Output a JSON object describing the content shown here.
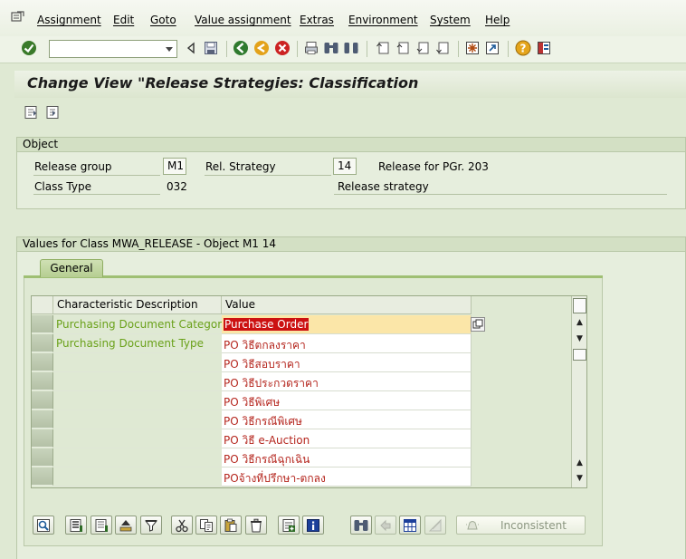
{
  "menu": [
    "Assignment",
    "Edit",
    "Goto",
    "Value assignment",
    "Extras",
    "Environment",
    "System",
    "Help"
  ],
  "command_field": {
    "value": ""
  },
  "title": "Change View \"Release Strategies: Classification",
  "object_group": {
    "title": "Object",
    "release_group_label": "Release group",
    "release_group_value": "M1",
    "rel_strategy_label": "Rel. Strategy",
    "rel_strategy_value": "14",
    "release_for_text": "Release for PGr. 203",
    "class_type_label": "Class Type",
    "class_type_value": "032",
    "release_strategy_text": "Release strategy"
  },
  "values_group": {
    "title": "Values for Class MWA_RELEASE - Object M1 14",
    "tab": "General"
  },
  "table": {
    "headers": [
      "Characteristic Description",
      "Value"
    ],
    "rows": [
      {
        "desc": "Purchasing Document Category",
        "value": "Purchase Order"
      },
      {
        "desc": "Purchasing Document Type",
        "value": "PO วิธีตกลงราคา"
      },
      {
        "desc": "",
        "value": "PO วิธีสอบราคา"
      },
      {
        "desc": "",
        "value": "PO วิธีประกวดราคา"
      },
      {
        "desc": "",
        "value": "PO วิธีพิเศษ"
      },
      {
        "desc": "",
        "value": "PO วิธีกรณีพิเศษ"
      },
      {
        "desc": "",
        "value": "PO วิธี e-Auction"
      },
      {
        "desc": "",
        "value": "PO วิธีกรณีฉุกเฉิน"
      },
      {
        "desc": "",
        "value": "POจ้างที่ปรึกษา-ตกลง"
      }
    ]
  },
  "bottom": {
    "inconsistent_label": "Inconsistent"
  },
  "colors": {
    "desc_text": "#6aa11a",
    "value_text": "#b5261e",
    "selection": "#cc1111",
    "active_row": "#fbe6a8"
  }
}
